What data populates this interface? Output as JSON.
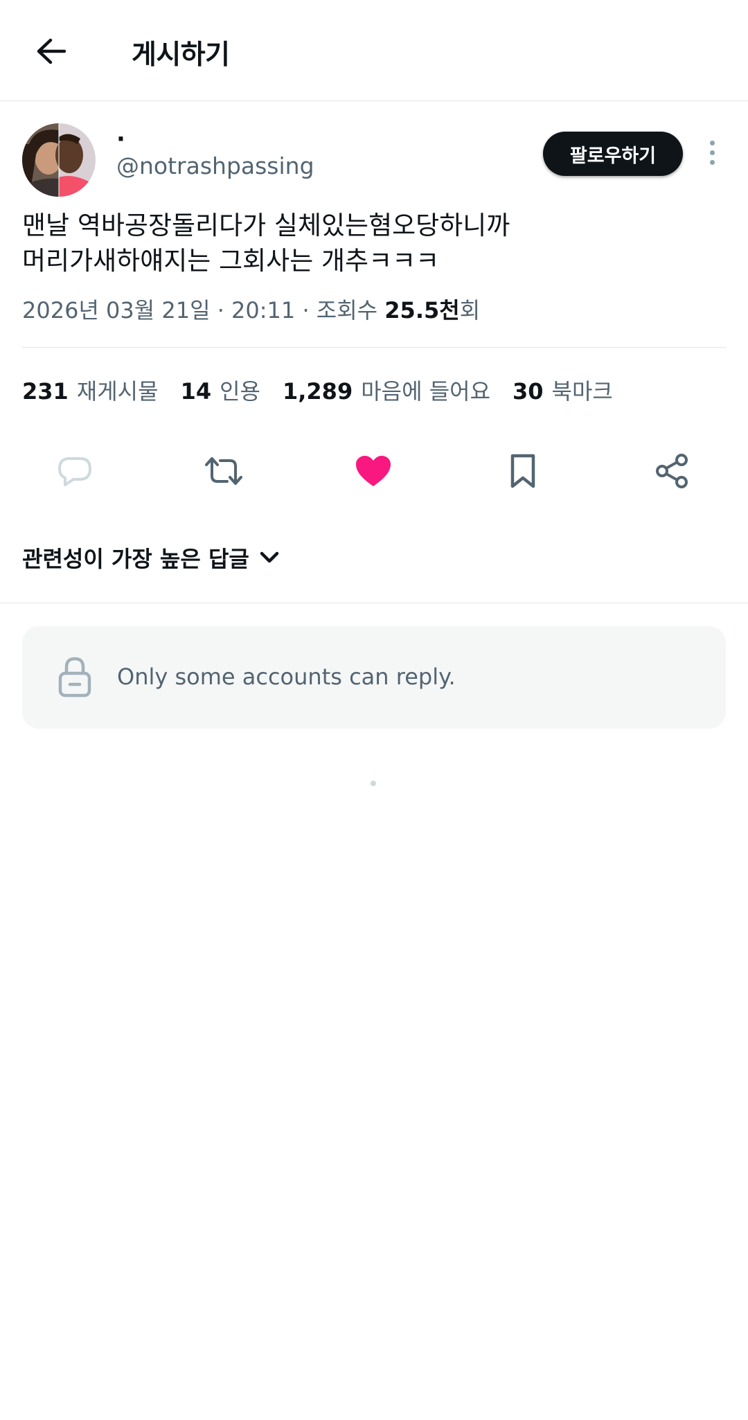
{
  "header": {
    "title": "게시하기",
    "back_icon": "arrow-left-icon"
  },
  "author": {
    "display_name": "·",
    "handle": "@notrashpassing",
    "follow_label": "팔로우하기"
  },
  "post": {
    "lines": [
      "맨날 역바공장돌리다가 실체있는혐오당하니까",
      "머리가새하얘지는 그회사는 개추ㅋㅋㅋ"
    ],
    "date": "2026년 03월 21일 · 20:11 · 조회수 ",
    "views_value": "25.5천",
    "views_suffix": "회"
  },
  "stats": [
    {
      "value": "231",
      "label": "재게시물"
    },
    {
      "value": "14",
      "label": "인용"
    },
    {
      "value": "1,289",
      "label": "마음에 들어요"
    },
    {
      "value": "30",
      "label": "북마크"
    }
  ],
  "actions": [
    {
      "icon": "reply-icon"
    },
    {
      "icon": "repost-icon"
    },
    {
      "icon": "heart-filled-icon"
    },
    {
      "icon": "bookmark-icon"
    },
    {
      "icon": "share-icon"
    }
  ],
  "replies": {
    "sort_label": "관련성이 가장 높은 답글",
    "restriction_text": "Only some accounts can reply."
  },
  "colors": {
    "like": "#f91880",
    "muted": "#536471",
    "follow_bg": "#0f1419"
  }
}
